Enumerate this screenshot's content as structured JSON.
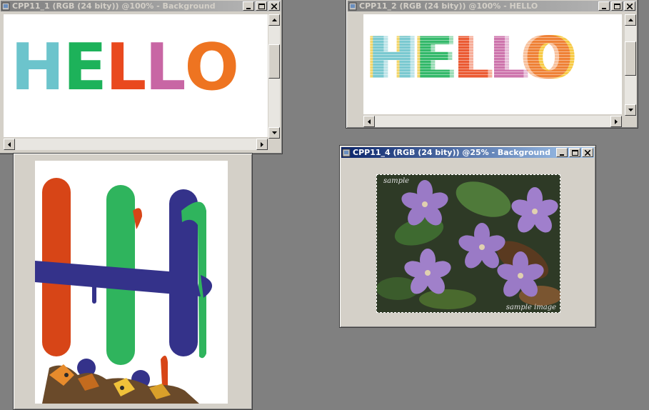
{
  "windows": {
    "cpp11_1": {
      "title": "CPP11_1 (RGB (24 bity)) @100% - Background"
    },
    "cpp11_2": {
      "title": "CPP11_2 (RGB (24 bity)) @100% - HELLO"
    },
    "cpp11_4": {
      "title": "CPP11_4 (RGB (24 bity)) @25% - Background"
    }
  },
  "hello": {
    "letters": [
      {
        "ch": "H",
        "color": "#6cc4cc"
      },
      {
        "ch": "E",
        "color": "#1db25a"
      },
      {
        "ch": "L",
        "color": "#e9491e"
      },
      {
        "ch": "L",
        "color": "#c866a4"
      },
      {
        "ch": "O",
        "color": "#ee7421"
      }
    ]
  },
  "photo": {
    "watermark_top": "sample",
    "watermark_bottom": "sample image"
  },
  "icons": [
    "app-icon",
    "minimize-icon",
    "maximize-icon",
    "close-icon",
    "arrow-up-icon",
    "arrow-down-icon",
    "arrow-left-icon",
    "arrow-right-icon"
  ]
}
